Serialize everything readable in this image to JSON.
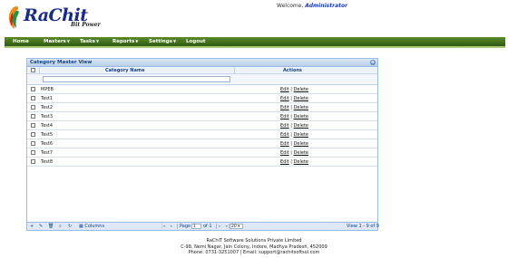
{
  "brand": {
    "name": "RaChit",
    "tagline": "Bit Power"
  },
  "welcome": {
    "prefix": "Welcome,",
    "user": "Administrator"
  },
  "nav": [
    {
      "label": "Home",
      "has_menu": false
    },
    {
      "label": "Masters",
      "has_menu": true
    },
    {
      "label": "Tasks",
      "has_menu": true
    },
    {
      "label": "Reports",
      "has_menu": true
    },
    {
      "label": "Settings",
      "has_menu": true
    },
    {
      "label": "Logout",
      "has_menu": false
    }
  ],
  "panel": {
    "title": "Category Master View",
    "columns": {
      "name": "Category Name",
      "actions": "Actions"
    },
    "rows": [
      {
        "name": "MPEB",
        "edit": "Edit",
        "sep": " | ",
        "delete": "Delete"
      },
      {
        "name": "Test1",
        "edit": "Edit",
        "sep": " | ",
        "delete": "Delete"
      },
      {
        "name": "Test2",
        "edit": "Edit",
        "sep": " | ",
        "delete": "Delete"
      },
      {
        "name": "Test3",
        "edit": "Edit",
        "sep": " | ",
        "delete": "Delete"
      },
      {
        "name": "Test4",
        "edit": "Edit",
        "sep": " | ",
        "delete": "Delete"
      },
      {
        "name": "Test5",
        "edit": "Edit",
        "sep": " | ",
        "delete": "Delete"
      },
      {
        "name": "Test6",
        "edit": "Edit",
        "sep": " | ",
        "delete": "Delete"
      },
      {
        "name": "Test7",
        "edit": "Edit",
        "sep": " | ",
        "delete": "Delete"
      },
      {
        "name": "Test8",
        "edit": "Edit",
        "sep": " | ",
        "delete": "Delete"
      }
    ],
    "pager": {
      "columns_label": "Columns",
      "page_label": "Page",
      "page_value": "1",
      "of_label": "of 1",
      "page_size": "20",
      "view_info": "View 1 - 9 of 9"
    }
  },
  "footer": {
    "company": "RaChiT Software Solutions Private Limited",
    "address": "C-98, Nemi Nagar, Jain Colony, Indore, Madhya Pradesh, 452009",
    "contact": "Phone: 0731-3251007 | Email: support@rachitsoftsol.com"
  },
  "colors": {
    "nav_bg": "#3f6d1c",
    "panel_border": "#99bbe8",
    "header_text": "#15428b",
    "brand_text": "#1a2a8a"
  }
}
